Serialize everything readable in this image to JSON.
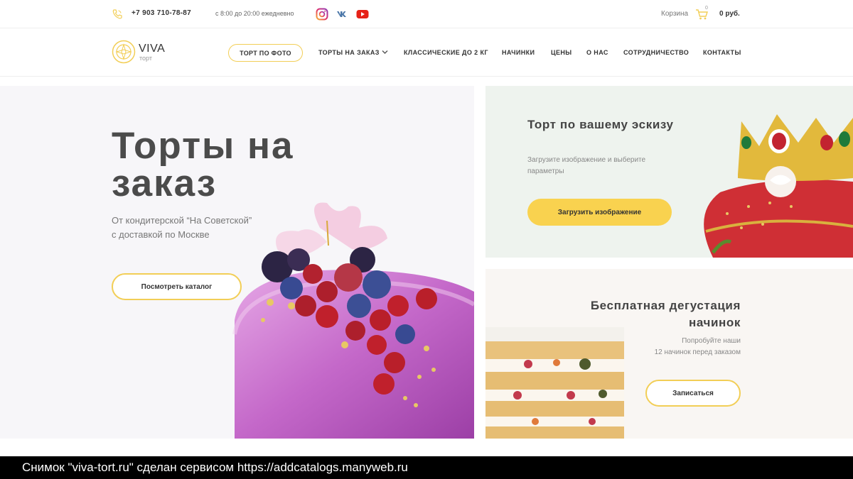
{
  "topbar": {
    "phone": "+7 903 710-78-87",
    "hours": "с 8:00 до 20:00 ежедневно",
    "phone_icon": "phone-icon",
    "socials": [
      "instagram-icon",
      "vk-icon",
      "youtube-icon"
    ],
    "cart_label": "Корзина",
    "cart_count": "0",
    "cart_sum": "0 руб."
  },
  "logo": {
    "title": "VIVA",
    "subtitle": "торт"
  },
  "nav": {
    "photo_cake": "ТОРТ ПО ФОТО",
    "items": [
      "ТОРТЫ НА ЗАКАЗ",
      "КЛАССИЧЕСКИЕ ДО 2 КГ",
      "НАЧИНКИ",
      "ЦЕНЫ",
      "О НАС",
      "СОТРУДНИЧЕСТВО",
      "КОНТАКТЫ"
    ]
  },
  "hero": {
    "title": "Торты на заказ",
    "subtitle_line1": "От кондитерской “На Советской”",
    "subtitle_line2": "с доставкой по Москве",
    "button": "Посмотреть каталог"
  },
  "card_sketch": {
    "title": "Торт по вашему эскизу",
    "text": "Загрузите изображение и выберите параметры",
    "button": "Загрузить изображение"
  },
  "card_tasting": {
    "title": "Бесплатная дегустация начинок",
    "text_line1": "Попробуйте наши",
    "text_line2": "12 начинок перед заказом",
    "button": "Записаться"
  },
  "caption": "Снимок \"viva-tort.ru\" сделан сервисом https://addcatalogs.manyweb.ru",
  "colors": {
    "accent": "#f9d24f",
    "outline": "#f2ce56",
    "text": "#444444",
    "hero_bg": "#f7f6f9",
    "card1_bg": "#eef3ee",
    "card2_bg": "#f9f6f3"
  }
}
